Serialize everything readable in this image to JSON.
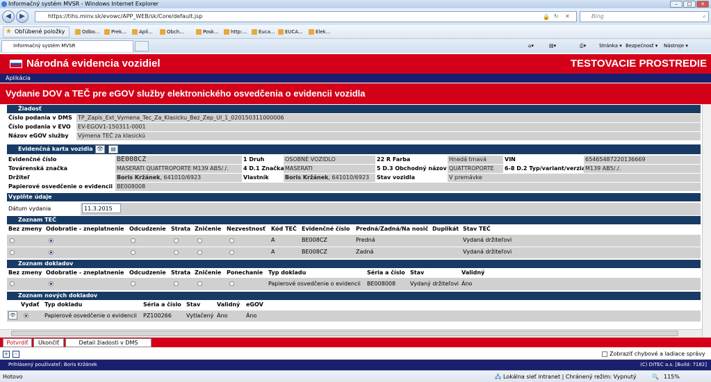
{
  "browser": {
    "window_title": "Informačný systém MVSR - Windows Internet Explorer",
    "url": "https://tihs.minv.sk/evowc/APP_WEB/sk/Core/default.jsp",
    "search_placeholder": "Bing",
    "favorites_label": "Obľúbené položky",
    "favorites": [
      "Odbo...",
      "Prek...",
      "Apli...",
      "Obch...",
      "Posk...",
      "http:...",
      "Euca...",
      "EUCA...",
      "Elek..."
    ],
    "tab_title": "Informačný systém MVSR",
    "tools": [
      "Stránka",
      "Bezpečnosť",
      "Nástroje"
    ]
  },
  "app": {
    "title": "Národná evidencia vozidiel",
    "env": "TESTOVACIE PROSTREDIE",
    "menu": "Aplikácia",
    "page_title": "Vydanie DOV a TEČ pre eGOV služby elektronického osvedčenia o evidencii vozidla"
  },
  "request": {
    "section": "Žiadosť",
    "rows": [
      {
        "label": "Číslo podania v DMS",
        "value": "TP_Zapis_Ext_Vymena_Tec_Za_Klasicku_Bez_Zep_Ul_1_020150311000006"
      },
      {
        "label": "Číslo podania v EVO",
        "value": "EV-EGOV1-150311-0001"
      },
      {
        "label": "Názov eGOV služby",
        "value": "Výmena TEČ za klasickú"
      }
    ]
  },
  "vehicle": {
    "section": "Evidenčná karta vozidla",
    "ev_label": "Evidenčné číslo",
    "ev_value": "BE008CZ",
    "druh_label": "1 Druh",
    "druh_value": "OSOBNÉ VOZIDLO",
    "farba_label": "22 R Farba",
    "farba_value": "Hnedá tmavá",
    "vin_label": "VIN",
    "vin_value": "65465487220136669",
    "tz_label": "Továrenská značka",
    "tz_value": "MASERATI QUATTROPORTE M139 AB5/./.",
    "znacka_label": "4 D.1 Značka",
    "znacka_value": "MASERATI",
    "obch_label": "5 D.3 Obchodný názov",
    "obch_value": "QUATTROPORTE",
    "typ_label": "6-8 D.2 Typ/variant/verzia",
    "typ_value": "M139 AB5/./.",
    "drzitel_label": "Držiteľ",
    "drzitel_name": "Boris Kržánek",
    "drzitel_rest": ", 641010/6923",
    "vlastnik_label": "Vlastník",
    "vlastnik_name": "Boris Kržánek",
    "vlastnik_rest": ", 641010/6923",
    "stav_label": "Stav vozidla",
    "stav_value": "V premávke",
    "po_label": "Papierové osvedčenie o evidencii",
    "po_value": "BE008008"
  },
  "fill": {
    "section": "Vyplňte údaje",
    "date_label": "Dátum vydania",
    "date_value": "11.3.2015"
  },
  "tec": {
    "section": "Zoznam TEČ",
    "headers": [
      "Bez zmeny",
      "Odobratie - zneplatnenie",
      "Odcudzenie",
      "Strata",
      "Zničenie",
      "Nezvestnosť",
      "Kód TEČ",
      "Evidenčné číslo",
      "Predná/Zadná/Na nosič",
      "Duplikát",
      "Stav TEČ"
    ],
    "rows": [
      {
        "kod": "A",
        "ev": "BE008CZ",
        "pos": "Predná",
        "dup": "",
        "stav": "Vydaná držiteľovi"
      },
      {
        "kod": "A",
        "ev": "BE008CZ",
        "pos": "Zadná",
        "dup": "",
        "stav": "Vydaná držiteľovi"
      }
    ]
  },
  "docs": {
    "section": "Zoznam dokladov",
    "headers": [
      "Bez zmeny",
      "Odobratie - zneplatnenie",
      "Odcudzenie",
      "Strata",
      "Zničenie",
      "Ponechanie",
      "Typ dokladu",
      "Séria a číslo",
      "Stav",
      "Validný"
    ],
    "rows": [
      {
        "typ": "Papierové osvedčenie o evidencii",
        "seria": "BE008008",
        "stav": "Vydaný držiteľovi",
        "valid": "Áno"
      }
    ]
  },
  "newdocs": {
    "section": "Zoznam nových dokladov",
    "headers": [
      "Vydať",
      "Typ dokladu",
      "Séria a číslo",
      "Stav",
      "Validný",
      "eGOV"
    ],
    "rows": [
      {
        "typ": "Papierové osvedčenie o evidencii",
        "seria": "PZ100266",
        "stav": "Vytlačený",
        "valid": "Áno",
        "egov": "Áno"
      }
    ]
  },
  "buttons": {
    "confirm": "Potvrdiť",
    "back": "Ukončiť",
    "detail": "Detail žiadosti v DMS"
  },
  "options": {
    "show_errors": "Zobraziť chybové a ladiace správy"
  },
  "footer": {
    "user": "Prihlásený používateľ: Boris Kržánek",
    "copyright": "(C) DITEC a.s. [Build: 7182]"
  },
  "status": {
    "left": "Hotovo",
    "zone": "Lokálna sieť intranet | Chránený režim: Vypnutý",
    "zoom": "115%"
  }
}
